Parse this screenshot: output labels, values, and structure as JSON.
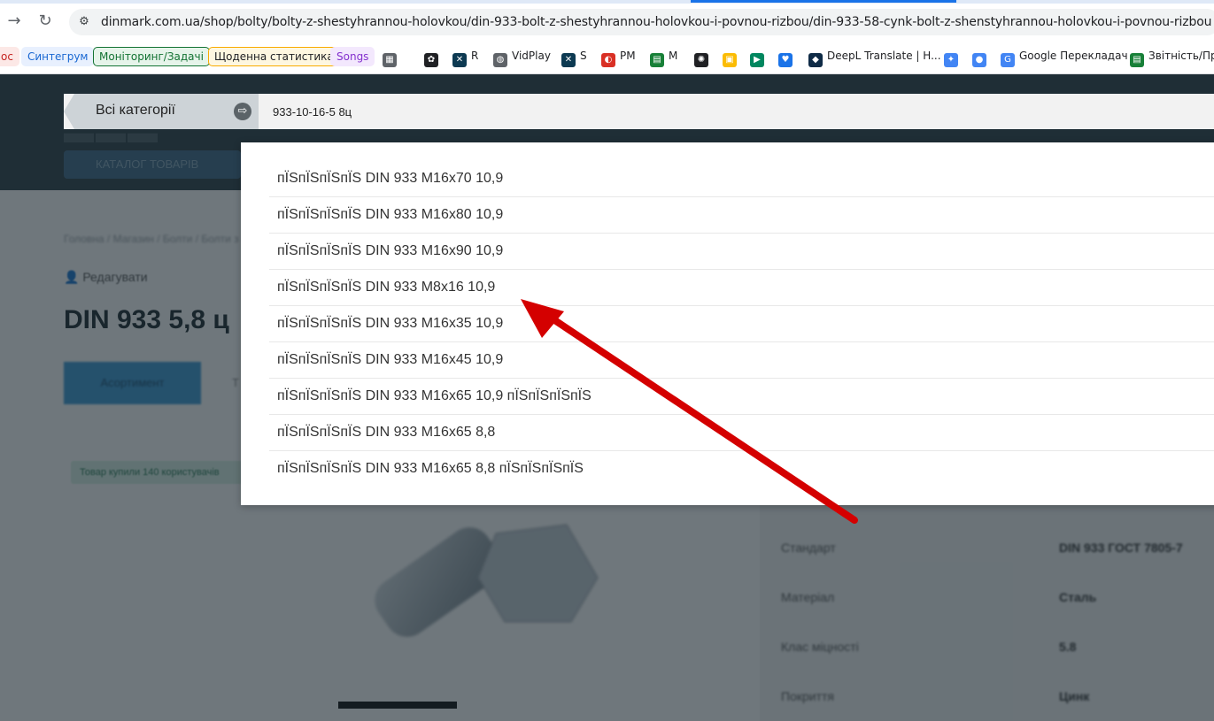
{
  "browser": {
    "back_icon": "arrow-left-icon",
    "forward_icon": "arrow-right-icon",
    "reload_icon": "reload-icon",
    "url": "dinmark.com.ua/shop/bolty/bolty-z-shestyhrannou-holovkou/din-933-bolt-z-shestyhrannou-holovkou-i-povnou-rizbou/din-933-58-cynk-bolt-z-shenstyhrannou-holovkou-i-povnou-rizbou",
    "active_tab_color": "#1a73e8"
  },
  "bookmarks": [
    {
      "label": "ос",
      "style": "tag",
      "bg": "#fce8e6",
      "fg": "#c5221f",
      "border": "#fce8e6"
    },
    {
      "label": "Синтегрум",
      "style": "tag",
      "bg": "#e8f0fe",
      "fg": "#1967d2",
      "border": "#e8f0fe"
    },
    {
      "label": "Моніторинг/Задачі",
      "style": "tag",
      "bg": "#e6f4ea",
      "fg": "#137333",
      "border": "#137333"
    },
    {
      "label": "Щоденна статистика",
      "style": "tag",
      "bg": "#fef7e0",
      "fg": "#202124",
      "border": "#f9ab00"
    },
    {
      "label": "Songs",
      "style": "tag",
      "bg": "#f3e8fd",
      "fg": "#8430ce",
      "border": "#f3e8fd"
    },
    {
      "label": "",
      "icon": "apps-grid-icon"
    },
    {
      "label": "",
      "icon": "chatgpt-icon"
    },
    {
      "label": "R",
      "icon": "bookmark-r-icon"
    },
    {
      "label": "VidPlay",
      "icon": "globe-icon"
    },
    {
      "label": "S",
      "icon": "bookmark-s-icon"
    },
    {
      "label": "PM",
      "icon": "bookmark-pm-icon"
    },
    {
      "label": "M",
      "icon": "sheets-icon"
    },
    {
      "label": "",
      "icon": "pixel-icon"
    },
    {
      "label": "",
      "icon": "meet-icon"
    },
    {
      "label": "",
      "icon": "play-icon"
    },
    {
      "label": "",
      "icon": "heart-icon"
    },
    {
      "label": "DeepL Translate | H...",
      "icon": "deepl-icon"
    },
    {
      "label": "",
      "icon": "gemini-icon"
    },
    {
      "label": "",
      "icon": "podcast-icon"
    },
    {
      "label": "Google Перекладач",
      "icon": "google-translate-icon"
    },
    {
      "label": "Звітність/Пра",
      "icon": "sheets-icon"
    }
  ],
  "site": {
    "catalog_button": "КАТАЛОГ ТОВАРІВ",
    "search": {
      "category_label": "Всі категорії",
      "category_icon": "arrow-circle-icon",
      "query": "933-10-16-5 8ц"
    },
    "breadcrumb": "Головна / Магазин / Болти / Болти з шестигранною головкою",
    "edit_label": "Редагувати",
    "product_title": "DIN 933 5,8 ц",
    "tabs": [
      "Асортимент",
      "Т"
    ],
    "stock_badge": "Товар купили 140 користувачів",
    "specs": [
      {
        "label": "Стандарт",
        "value": "DIN 933    ГОСТ 7805-7"
      },
      {
        "label": "Матеріал",
        "value": "Сталь"
      },
      {
        "label": "Клас міцності",
        "value": "5.8"
      },
      {
        "label": "Покриття",
        "value": "Цинк"
      }
    ]
  },
  "suggestions": [
    "пЇЅпЇЅпЇЅпЇЅ DIN 933 M16x70 10,9",
    "пЇЅпЇЅпЇЅпЇЅ DIN 933 M16x80 10,9",
    "пЇЅпЇЅпЇЅпЇЅ DIN 933 M16x90 10,9",
    "пЇЅпЇЅпЇЅпЇЅ DIN 933 M8x16 10,9",
    "пЇЅпЇЅпЇЅпЇЅ DIN 933 M16x35 10,9",
    "пЇЅпЇЅпЇЅпЇЅ DIN 933 M16x45 10,9",
    "пЇЅпЇЅпЇЅпЇЅ DIN 933 M16x65 10,9 пЇЅпЇЅпЇЅпЇЅ",
    "пЇЅпЇЅпЇЅпЇЅ DIN 933 M16x65 8,8",
    "пЇЅпЇЅпЇЅпЇЅ DIN 933 M16x65 8,8 пЇЅпЇЅпЇЅпЇЅ"
  ],
  "annotation": {
    "type": "arrow",
    "color": "#d40000",
    "points_to": "пЇЅпЇЅпЇЅпЇЅ DIN 933 M8x16 10,9"
  }
}
